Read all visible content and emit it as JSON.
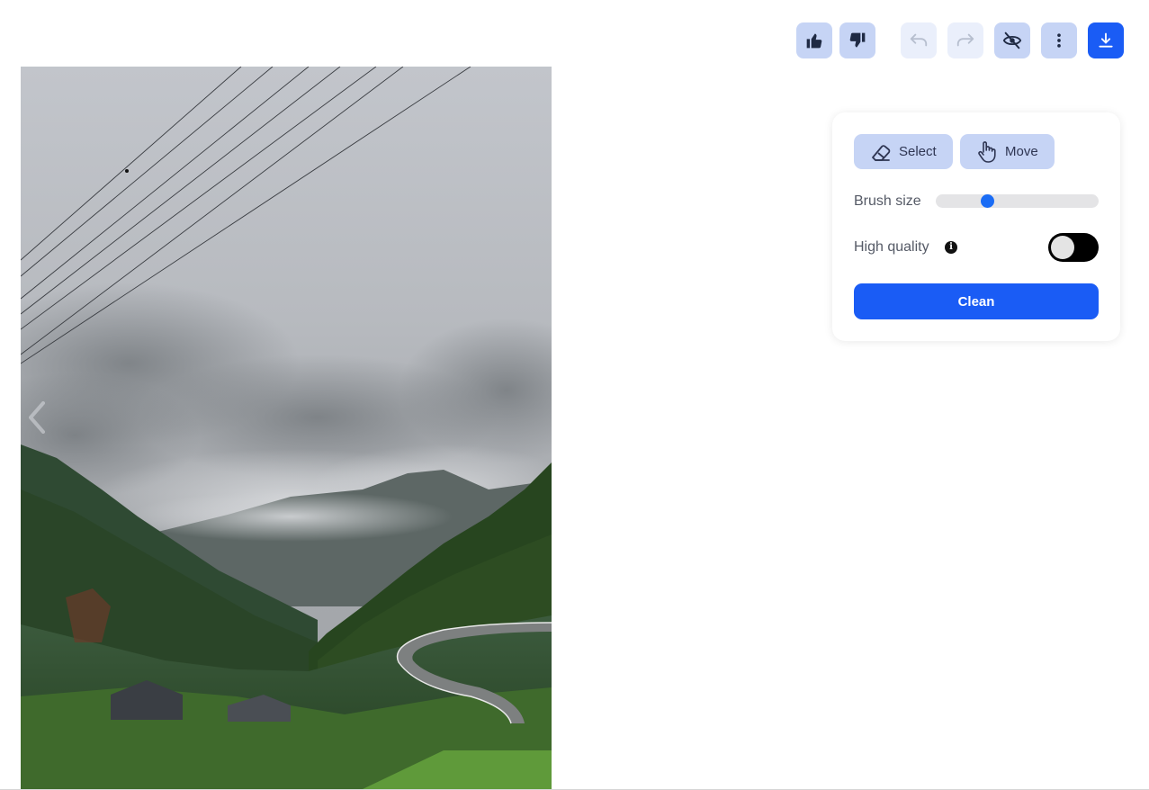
{
  "toolbar": {
    "buttons": [
      {
        "name": "thumbs-up",
        "icon": "thumbs-up-icon"
      },
      {
        "name": "thumbs-down",
        "icon": "thumbs-down-icon"
      },
      {
        "name": "undo",
        "icon": "undo-icon",
        "state": "disabled"
      },
      {
        "name": "redo",
        "icon": "redo-icon",
        "state": "disabled"
      },
      {
        "name": "toggle-visibility",
        "icon": "eye-off-icon"
      },
      {
        "name": "more",
        "icon": "more-vertical-icon"
      },
      {
        "name": "download",
        "icon": "download-icon"
      }
    ]
  },
  "panel": {
    "select_label": "Select",
    "move_label": "Move",
    "brush_label": "Brush size",
    "brush_value": 0.32,
    "quality_label": "High quality",
    "quality_on": false,
    "clean_label": "Clean"
  },
  "colors": {
    "primary": "#1a5cf5",
    "button_light": "#c6d4f5",
    "button_faded": "#eaeffb",
    "slider_thumb": "#1a6cf5",
    "toggle_bg": "#000000"
  }
}
